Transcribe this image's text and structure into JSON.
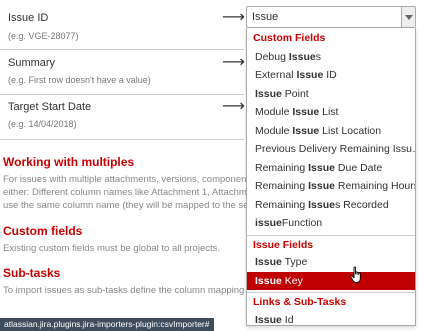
{
  "mapping_rows": [
    {
      "label": "Issue ID",
      "example": "(e.g. VGE-28077)"
    },
    {
      "label": "Summary",
      "example": "(e.g. First row doesn't have a value)"
    },
    {
      "label": "Target Start Date",
      "example": "(e.g. 14/04/2018)"
    }
  ],
  "arrow_glyph": "⟶",
  "sections": {
    "multiples": {
      "title": "Working with multiples",
      "lines": [
        "For issues with multiple attachments, versions, component",
        "either: Different column names like Attachment 1, Attachm",
        "use the same column name (they will be mapped to the se"
      ]
    },
    "custom": {
      "title": "Custom fields",
      "lines": [
        "Existing custom fields must be global to all projects."
      ]
    },
    "subtasks": {
      "title": "Sub-tasks",
      "lines": [
        "To import issues as sub-tasks define the column mapping"
      ]
    }
  },
  "status_bar": "atlassian.jira.plugins.jira-importers-plugin:csvImporter#",
  "select": {
    "value": "Issue",
    "search_term": "Issue",
    "groups": [
      {
        "header": "Custom Fields",
        "options": [
          "Debug Issues",
          "External Issue ID",
          "Issue Point",
          "Module Issue List",
          "Module Issue List Location",
          "Previous Delivery Remaining Issu…",
          "Remaining Issue Due Date",
          "Remaining Issue Remaining Hours",
          "Remaining Issues Recorded",
          "issueFunction"
        ]
      },
      {
        "header": "Issue Fields",
        "options": [
          "Issue Type",
          "Issue Key"
        ]
      },
      {
        "header": "Links & Sub-Tasks",
        "options": [
          "Issue Id"
        ]
      }
    ],
    "highlighted_option": "Issue Key"
  },
  "colors": {
    "accent_red": "#cc0000",
    "highlight_bg": "#c00000",
    "status_bar_bg": "#3f4c5c"
  },
  "icons": {
    "select_arrow": "chevron-down-icon",
    "cursor": "hand-pointer-icon"
  }
}
